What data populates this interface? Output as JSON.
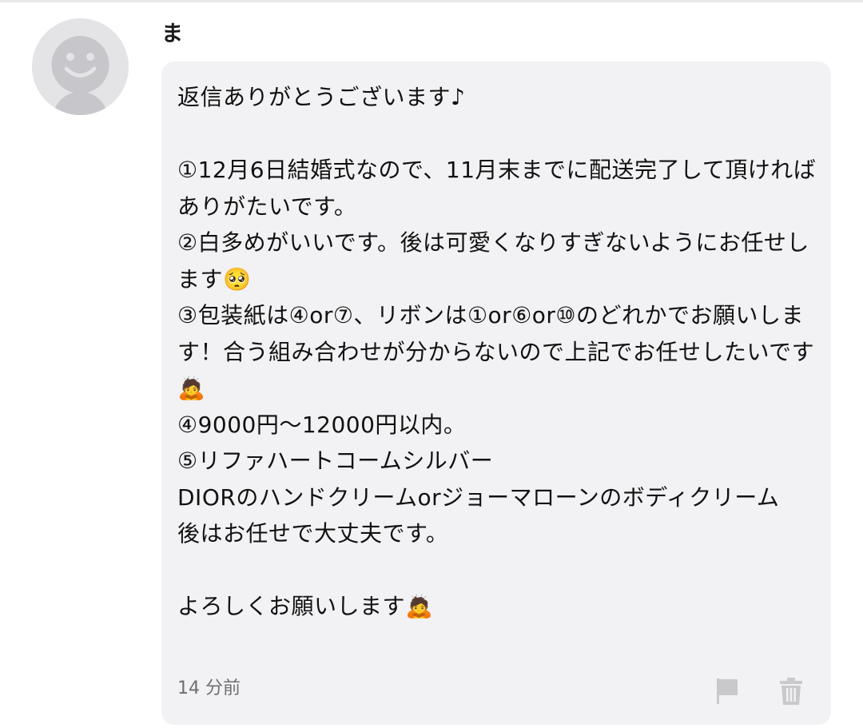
{
  "comment": {
    "author": "ま",
    "avatar_icon": "default-user-avatar-icon",
    "message": "返信ありがとうございます♪\n\n①12月6日結婚式なので、11月末までに配送完了して頂ければありがたいです。\n②白多めがいいです。後は可愛くなりすぎないようにお任せします🥺\n③包装紙は④or⑦、リボンは①or⑥or⑩のどれかでお願いします！合う組み合わせが分からないので上記でお任せしたいです🙇\n④9000円〜12000円以内。\n⑤リファハートコームシルバー\nDIORのハンドクリームorジョーマローンのボディクリーム\n後はお任せで大丈夫です。\n\nよろしくお願いします🙇",
    "timestamp": "14 分前",
    "actions": {
      "flag_icon": "flag-icon",
      "delete_icon": "trash-icon"
    }
  },
  "colors": {
    "bubble_bg": "#f2f2f4",
    "avatar_bg": "#e4e3e6",
    "avatar_fg": "#c7c6ca",
    "icon_gray": "#c9c9cc",
    "timestamp": "#6e6e73"
  }
}
